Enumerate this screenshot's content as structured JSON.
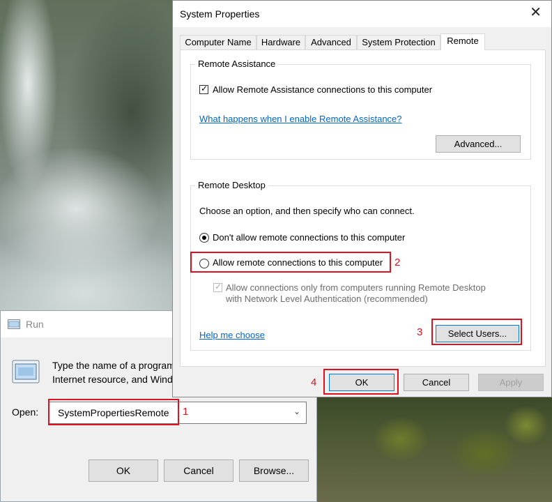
{
  "run_dialog": {
    "title": "Run",
    "description_line1": "Type the name of a program, folder, document, or",
    "description_line2": "Internet resource, and Windows will open it for you.",
    "open_label": "Open:",
    "open_value": "SystemPropertiesRemote",
    "ok_label": "OK",
    "cancel_label": "Cancel",
    "browse_label": "Browse..."
  },
  "system_properties": {
    "title": "System Properties",
    "tabs": [
      {
        "label": "Computer Name",
        "active": false
      },
      {
        "label": "Hardware",
        "active": false
      },
      {
        "label": "Advanced",
        "active": false
      },
      {
        "label": "System Protection",
        "active": false
      },
      {
        "label": "Remote",
        "active": true
      }
    ],
    "remote_assistance": {
      "group_label": "Remote Assistance",
      "allow_checkbox_label": "Allow Remote Assistance connections to this computer",
      "allow_checked": true,
      "help_link": "What happens when I enable Remote Assistance?",
      "advanced_button": "Advanced..."
    },
    "remote_desktop": {
      "group_label": "Remote Desktop",
      "instruction": "Choose an option, and then specify who can connect.",
      "options": [
        {
          "label": "Don't allow remote connections to this computer",
          "selected": true
        },
        {
          "label": "Allow remote connections to this computer",
          "selected": false
        }
      ],
      "nla_label_line1": "Allow connections only from computers running Remote Desktop",
      "nla_label_line2": "with Network Level Authentication (recommended)",
      "nla_checked": true,
      "help_link": "Help me choose",
      "select_users_button": "Select Users..."
    },
    "buttons": {
      "ok": "OK",
      "cancel": "Cancel",
      "apply": "Apply"
    }
  },
  "annotations": {
    "color": "#e0101e",
    "steps": [
      "1",
      "2",
      "3",
      "4"
    ]
  }
}
